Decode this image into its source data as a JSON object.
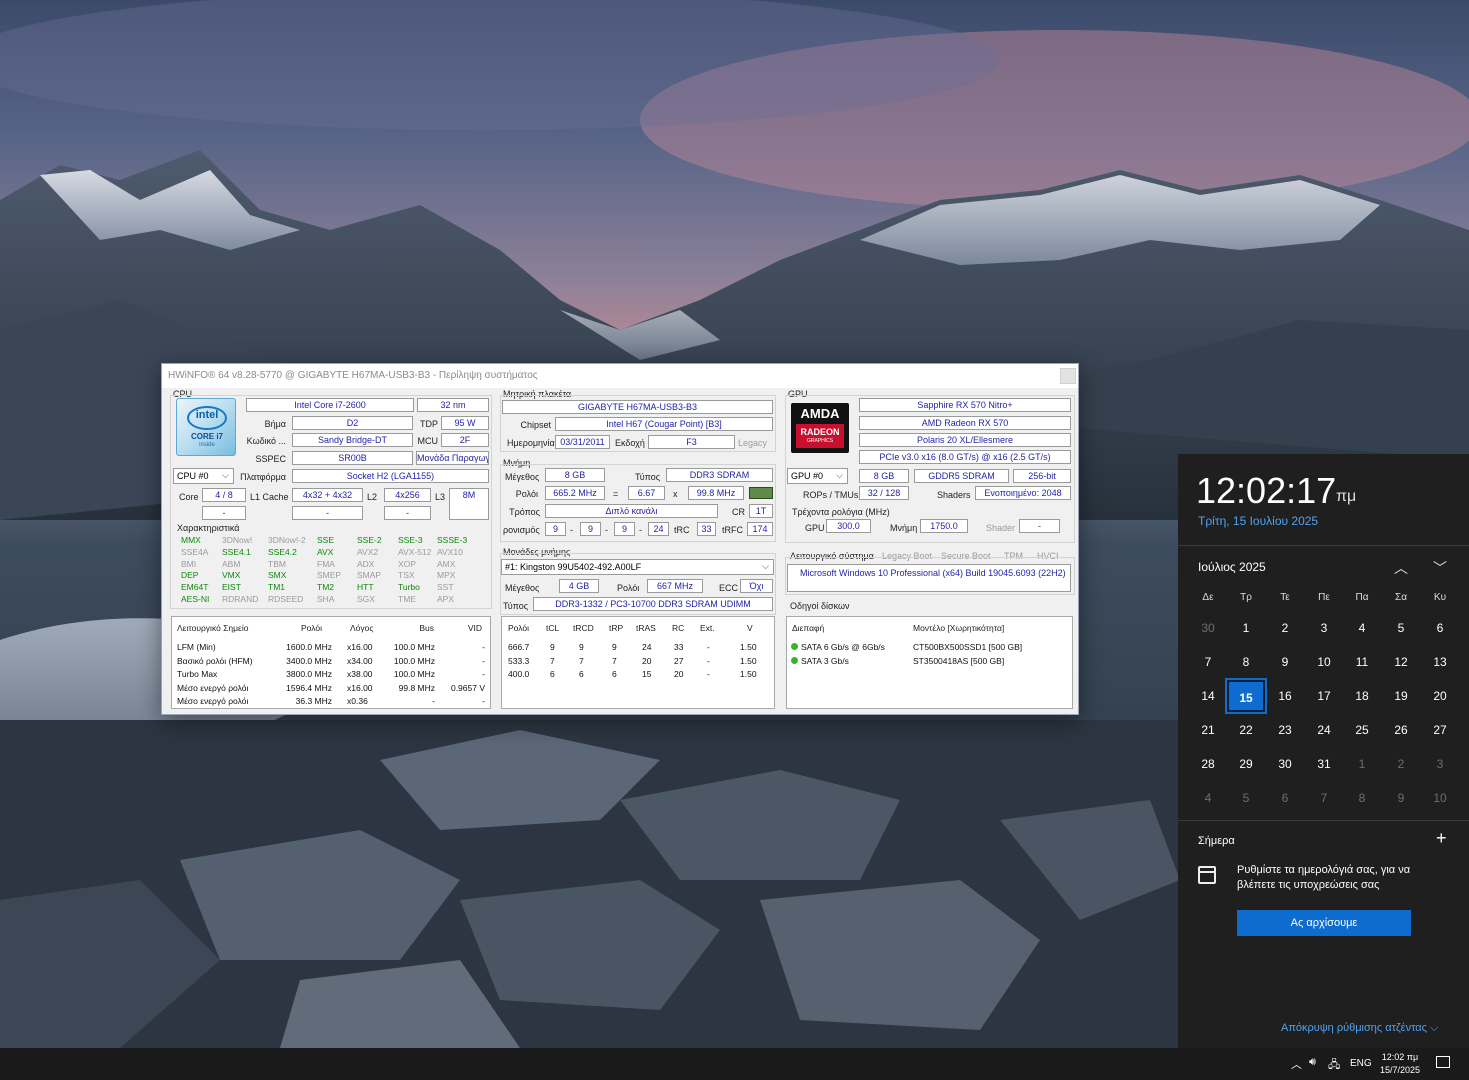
{
  "window": {
    "title": "HWiNFO® 64 v8.28-5770 @ GIGABYTE H67MA-USB3-B3 - Περίληψη συστήματος"
  },
  "cpu": {
    "section": "CPU",
    "logo": "intel-core-i7-logo",
    "logo_text": [
      "intel",
      "CORE i7",
      "inside"
    ],
    "name": "Intel Core i7-2600",
    "process": "32 nm",
    "stepping_label": "Βήμα",
    "stepping": "D2",
    "tdp_label": "TDP",
    "tdp": "95 W",
    "codename_label": "Κωδικό ...",
    "codename": "Sandy Bridge-DT",
    "mcu_label": "MCU",
    "mcu": "2F",
    "sspec_label": "SSPEC",
    "sspec": "SR00B",
    "prod_unit": "Μονάδα Παραγωγ",
    "selector": "CPU #0",
    "platform_label": "Πλατφόρμα",
    "platform": "Socket H2 (LGA1155)",
    "core_label": "Core",
    "core": "4 / 8",
    "l1_label": "L1 Cache",
    "l1": "4x32 + 4x32",
    "l2_label": "L2",
    "l2": "4x256",
    "l3_label": "L3",
    "l3": "8M",
    "dash": "-",
    "features_label": "Χαρακτηριστικά",
    "features": [
      [
        {
          "t": "MMX",
          "on": true
        },
        {
          "t": "3DNow!",
          "on": false
        },
        {
          "t": "3DNow!-2",
          "on": false
        },
        {
          "t": "SSE",
          "on": true
        },
        {
          "t": "SSE-2",
          "on": true
        },
        {
          "t": "SSE-3",
          "on": true
        },
        {
          "t": "SSSE-3",
          "on": true
        }
      ],
      [
        {
          "t": "SSE4A",
          "on": false
        },
        {
          "t": "SSE4.1",
          "on": true
        },
        {
          "t": "SSE4.2",
          "on": true
        },
        {
          "t": "AVX",
          "on": true
        },
        {
          "t": "AVX2",
          "on": false
        },
        {
          "t": "AVX-512",
          "on": false
        },
        {
          "t": "AVX10",
          "on": false
        }
      ],
      [
        {
          "t": "BMI",
          "on": false
        },
        {
          "t": "ABM",
          "on": false
        },
        {
          "t": "TBM",
          "on": false
        },
        {
          "t": "FMA",
          "on": false
        },
        {
          "t": "ADX",
          "on": false
        },
        {
          "t": "XOP",
          "on": false
        },
        {
          "t": "AMX",
          "on": false
        }
      ],
      [
        {
          "t": "DEP",
          "on": true
        },
        {
          "t": "VMX",
          "on": true
        },
        {
          "t": "SMX",
          "on": true
        },
        {
          "t": "SMEP",
          "on": false
        },
        {
          "t": "SMAP",
          "on": false
        },
        {
          "t": "TSX",
          "on": false
        },
        {
          "t": "MPX",
          "on": false
        }
      ],
      [
        {
          "t": "EM64T",
          "on": true
        },
        {
          "t": "EIST",
          "on": true
        },
        {
          "t": "TM1",
          "on": true
        },
        {
          "t": "TM2",
          "on": true
        },
        {
          "t": "HTT",
          "on": true
        },
        {
          "t": "Turbo",
          "on": true
        },
        {
          "t": "SST",
          "on": false
        }
      ],
      [
        {
          "t": "AES-NI",
          "on": true
        },
        {
          "t": "RDRAND",
          "on": false
        },
        {
          "t": "RDSEED",
          "on": false
        },
        {
          "t": "SHA",
          "on": false
        },
        {
          "t": "SGX",
          "on": false
        },
        {
          "t": "TME",
          "on": false
        },
        {
          "t": "APX",
          "on": false
        }
      ]
    ],
    "op_table": {
      "headers": [
        "Λειτουργικό Σημείο",
        "Ρολόι",
        "Λόγος",
        "Bus",
        "VID"
      ],
      "rows": [
        [
          "LFM (Min)",
          "1600.0 MHz",
          "x16.00",
          "100.0 MHz",
          "-"
        ],
        [
          "Βασικό ρολόι (HFM)",
          "3400.0 MHz",
          "x34.00",
          "100.0 MHz",
          "-"
        ],
        [
          "Turbo Max",
          "3800.0 MHz",
          "x38.00",
          "100.0 MHz",
          "-"
        ],
        [
          "Μέσο ενεργό ρολόι",
          "1596.4 MHz",
          "x16.00",
          "99.8 MHz",
          "0.9657 V"
        ],
        [
          "Μέσο ενεργό ρολόι",
          "36.3 MHz",
          "x0.36",
          "-",
          "-"
        ]
      ]
    }
  },
  "motherboard": {
    "section": "Μητρική πλακέτα",
    "name": "GIGABYTE H67MA-USB3-B3",
    "chipset_label": "Chipset",
    "chipset": "Intel H67 (Cougar Point) [B3]",
    "date_label": "Ημερομηνία",
    "date": "03/31/2011",
    "version_label": "Εκδοχή",
    "version": "F3",
    "legacy": "Legacy"
  },
  "memory": {
    "section": "Μνήμη",
    "size_label": "Μέγεθος",
    "size": "8 GB",
    "type_label": "Τύπος",
    "type": "DDR3 SDRAM",
    "clock_label": "Ρολόι",
    "clock": "665.2 MHz",
    "eq": "=",
    "mult": "6.67",
    "x": "x",
    "bus": "99.8 MHz",
    "mode_label": "Τρόπος",
    "mode": "Διπλό κανάλι",
    "cr_label": "CR",
    "cr": "1T",
    "timing_label": "ρονισμός",
    "timings": [
      "9",
      "9",
      "9",
      "24"
    ],
    "trc_label": "tRC",
    "trc": "33",
    "trfc_label": "tRFC",
    "trfc": "174",
    "modules_label": "Μονάδες μνήμης",
    "module": "#1: Kingston 99U5402-492.A00LF",
    "mod_size_label": "Μέγεθος",
    "mod_size": "4 GB",
    "mod_clock_label": "Ρολόι",
    "mod_clock": "667 MHz",
    "ecc_label": "ECC",
    "ecc": "Όχι",
    "mod_type_label": "Τύπος",
    "mod_type": "DDR3-1332 / PC3-10700 DDR3 SDRAM UDIMM",
    "timing_table": {
      "headers": [
        "Ρολόι",
        "tCL",
        "tRCD",
        "tRP",
        "tRAS",
        "RC",
        "Ext.",
        "V"
      ],
      "rows": [
        [
          "666.7",
          "9",
          "9",
          "9",
          "24",
          "33",
          "-",
          "1.50"
        ],
        [
          "533.3",
          "7",
          "7",
          "7",
          "20",
          "27",
          "-",
          "1.50"
        ],
        [
          "400.0",
          "6",
          "6",
          "6",
          "15",
          "20",
          "-",
          "1.50"
        ]
      ]
    }
  },
  "gpu": {
    "section": "GPU",
    "logo": "amd-radeon-logo",
    "logo_text": [
      "AMDA",
      "RADEON",
      "GRAPHICS"
    ],
    "board": "Sapphire RX 570 Nitro+",
    "name": "AMD Radeon RX 570",
    "core": "Polaris 20 XL/Ellesmere",
    "pcie": "PCIe v3.0 x16 (8.0 GT/s) @ x16 (2.5 GT/s)",
    "selector": "GPU #0",
    "vram": "8 GB",
    "vram_type": "GDDR5 SDRAM",
    "bus_width": "256-bit",
    "rops_label": "ROPs / TMUs",
    "rops": "32 / 128",
    "shaders_label": "Shaders",
    "shaders": "Ενοποιημένο: 2048",
    "clocks_label": "Τρέχοντα ρολόγια (MHz)",
    "gpu_clk_label": "GPU",
    "gpu_clk": "300.0",
    "mem_clk_label": "Μνήμη",
    "mem_clk": "1750.0",
    "shader_clk_label": "Shader",
    "shader_clk": "-"
  },
  "os": {
    "section": "Λειτουργικό σύστημα",
    "flags": [
      "Legacy Boot",
      "Secure Boot",
      "TPM",
      "HVCI"
    ],
    "name": "Microsoft Windows 10 Professional (x64) Build 19045.6093 (22H2)"
  },
  "drives": {
    "section": "Οδηγοί δίσκων",
    "headers": [
      "Διεπαφή",
      "Μοντέλο [Χωρητικότητα]"
    ],
    "rows": [
      [
        "SATA 6 Gb/s @ 6Gb/s",
        "CT500BX500SSD1 [500 GB]"
      ],
      [
        "SATA 3 Gb/s",
        "ST3500418AS [500 GB]"
      ]
    ],
    "status_color": "#2fb52f"
  },
  "calendar": {
    "time": "12:02:17",
    "ampm": "πμ",
    "date": "Τρίτη, 15 Ιουλίου 2025",
    "month": "Ιούλιος 2025",
    "weekdays": [
      "Δε",
      "Τρ",
      "Τε",
      "Πε",
      "Πα",
      "Σα",
      "Κυ"
    ],
    "days": [
      [
        {
          "d": "30",
          "cur": false
        },
        {
          "d": "1",
          "cur": true
        },
        {
          "d": "2",
          "cur": true
        },
        {
          "d": "3",
          "cur": true
        },
        {
          "d": "4",
          "cur": true
        },
        {
          "d": "5",
          "cur": true
        },
        {
          "d": "6",
          "cur": true
        }
      ],
      [
        {
          "d": "7",
          "cur": true
        },
        {
          "d": "8",
          "cur": true
        },
        {
          "d": "9",
          "cur": true
        },
        {
          "d": "10",
          "cur": true
        },
        {
          "d": "11",
          "cur": true
        },
        {
          "d": "12",
          "cur": true
        },
        {
          "d": "13",
          "cur": true
        }
      ],
      [
        {
          "d": "14",
          "cur": true
        },
        {
          "d": "15",
          "cur": true,
          "today": true
        },
        {
          "d": "16",
          "cur": true
        },
        {
          "d": "17",
          "cur": true
        },
        {
          "d": "18",
          "cur": true
        },
        {
          "d": "19",
          "cur": true
        },
        {
          "d": "20",
          "cur": true
        }
      ],
      [
        {
          "d": "21",
          "cur": true
        },
        {
          "d": "22",
          "cur": true
        },
        {
          "d": "23",
          "cur": true
        },
        {
          "d": "24",
          "cur": true
        },
        {
          "d": "25",
          "cur": true
        },
        {
          "d": "26",
          "cur": true
        },
        {
          "d": "27",
          "cur": true
        }
      ],
      [
        {
          "d": "28",
          "cur": true
        },
        {
          "d": "29",
          "cur": true
        },
        {
          "d": "30",
          "cur": true
        },
        {
          "d": "31",
          "cur": true
        },
        {
          "d": "1",
          "cur": false
        },
        {
          "d": "2",
          "cur": false
        },
        {
          "d": "3",
          "cur": false
        }
      ],
      [
        {
          "d": "4",
          "cur": false
        },
        {
          "d": "5",
          "cur": false
        },
        {
          "d": "6",
          "cur": false
        },
        {
          "d": "7",
          "cur": false
        },
        {
          "d": "8",
          "cur": false
        },
        {
          "d": "9",
          "cur": false
        },
        {
          "d": "10",
          "cur": false
        }
      ]
    ],
    "today_label": "Σήμερα",
    "message": "Ρυθμίστε τα ημερολόγιά σας, για να βλέπετε τις υποχρεώσεις σας",
    "start_button": "Ας αρχίσουμε",
    "hide_agenda": "Απόκρυψη ρύθμισης ατζέντας",
    "accent": "#0f6ccf"
  },
  "taskbar": {
    "language": "ENG",
    "time": "12:02 πμ",
    "date": "15/7/2025"
  }
}
